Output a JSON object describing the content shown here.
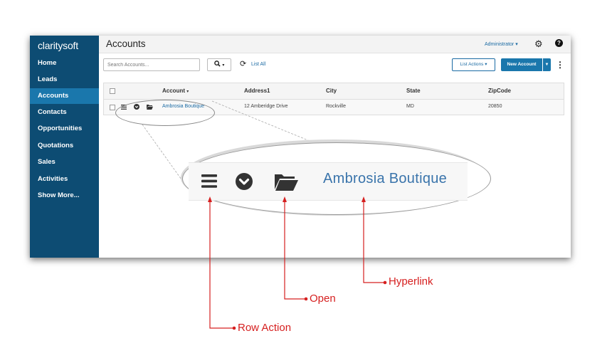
{
  "app": {
    "logo": "claritysoft",
    "brand_color": "#0d4c73",
    "accent_color": "#1a77ac"
  },
  "sidebar": {
    "items": [
      {
        "label": "Home",
        "active": false
      },
      {
        "label": "Leads",
        "active": false
      },
      {
        "label": "Accounts",
        "active": true
      },
      {
        "label": "Contacts",
        "active": false
      },
      {
        "label": "Opportunities",
        "active": false
      },
      {
        "label": "Quotations",
        "active": false
      },
      {
        "label": "Sales",
        "active": false
      },
      {
        "label": "Activities",
        "active": false
      },
      {
        "label": "Show More...",
        "active": false
      }
    ]
  },
  "header": {
    "title": "Accounts",
    "user": "Administrator",
    "gear_icon": "gear-icon",
    "help_icon": "help-icon"
  },
  "toolbar": {
    "search_placeholder": "Search Accounts...",
    "search_icon": "search-icon",
    "refresh_icon": "refresh-icon",
    "list_all": "List All",
    "list_actions": "List Actions",
    "new_account": "New Account"
  },
  "table": {
    "columns": [
      "Account",
      "Address1",
      "City",
      "State",
      "ZipCode"
    ],
    "sorted_column": "Account",
    "rows": [
      {
        "account": "Ambrosia Boutique",
        "address1": "12 Amberidge Drive",
        "city": "Rockville",
        "state": "MD",
        "zipcode": "20850"
      }
    ],
    "row_icons": [
      "menu-icon",
      "chevron-circle-icon",
      "folder-open-icon"
    ]
  },
  "zoom": {
    "link_text": "Ambrosia Boutique"
  },
  "callouts": {
    "color": "#d62020",
    "hyperlink": "Hyperlink",
    "open": "Open",
    "row_action": "Row Action"
  }
}
